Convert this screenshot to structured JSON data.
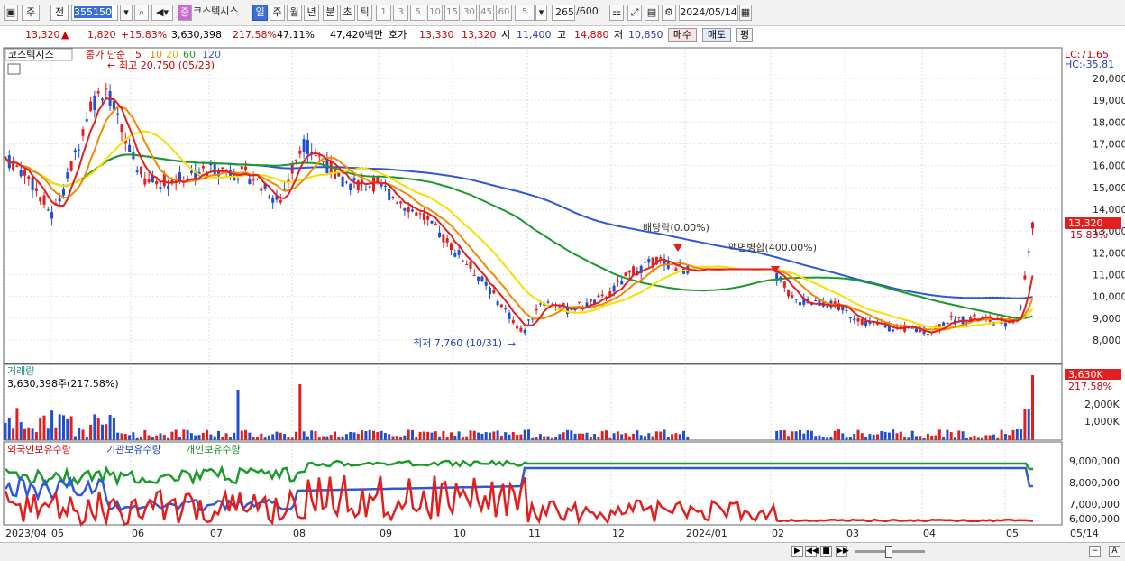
{
  "toolbar": {
    "market": "주",
    "prev": "전",
    "code": "355150",
    "name_tag": "증",
    "name": "코스텍시스",
    "periods": [
      "일",
      "주",
      "월",
      "년",
      "분",
      "초",
      "틱"
    ],
    "intervals": [
      "1",
      "3",
      "5",
      "10",
      "15",
      "30",
      "45",
      "60"
    ],
    "unit": "5",
    "count": "265",
    "count_total": "/600",
    "date": "2024/05/14"
  },
  "quote": {
    "price": "13,320",
    "arrow": "▲",
    "change": "1,820",
    "change_pct": "+15.83%",
    "volume": "3,630,398",
    "volume_pct": "217.58%",
    "ratio": "47.11%",
    "amount": "47,420백만",
    "ask_label": "호가",
    "ask1": "13,330",
    "ask2": "13,320",
    "open_label": "시",
    "open": "11,400",
    "high_label": "고",
    "high": "14,880",
    "low_label": "저",
    "low": "10,850",
    "buy": "매수",
    "sell": "매도",
    "eval": "평"
  },
  "price_panel": {
    "legend_name": "코스텍시스",
    "legend_ma_label": "종가 단순",
    "legend_ma": [
      "5",
      "10",
      "20",
      "60",
      "120"
    ],
    "lc": "LC:71.65",
    "hc": "HC:-35.81",
    "high_note": "최고 20,750 (05/23)",
    "low_note": "최저 7,760 (10/31)",
    "dividend_note": "배당락(0.00%)",
    "split_note": "액면병합(400.00%)",
    "current_price": "13,320",
    "current_pct": "15.83%",
    "yticks": [
      "20,000",
      "19,000",
      "18,000",
      "17,000",
      "16,000",
      "15,000",
      "14,000",
      "13,000",
      "12,000",
      "11,000",
      "10,000",
      "9,000",
      "8,000"
    ]
  },
  "volume_panel": {
    "title": "거래량",
    "detail": "3,630,398주(217.58%)",
    "current": "3,630K",
    "current_pct": "217.58%",
    "yticks": [
      "2,000K",
      "1,000K"
    ]
  },
  "holding_panel": {
    "legends": [
      "외국인보유수량",
      "기관보유수량",
      "개인보유수량"
    ],
    "yticks": [
      "9,000,000",
      "8,000,000",
      "7,000,000",
      "6,000,000"
    ]
  },
  "xaxis": [
    "2023/04",
    "05",
    "06",
    "07",
    "08",
    "09",
    "10",
    "11",
    "12",
    "2024/01",
    "02",
    "03",
    "04",
    "05",
    "05/14"
  ],
  "colors": {
    "up": "#e31e1e",
    "down": "#1f4fd0",
    "ma5": "#e31e1e",
    "ma10": "#f08a00",
    "ma20": "#f5e000",
    "ma60": "#1a9a2a",
    "ma120": "#3057d6"
  }
}
